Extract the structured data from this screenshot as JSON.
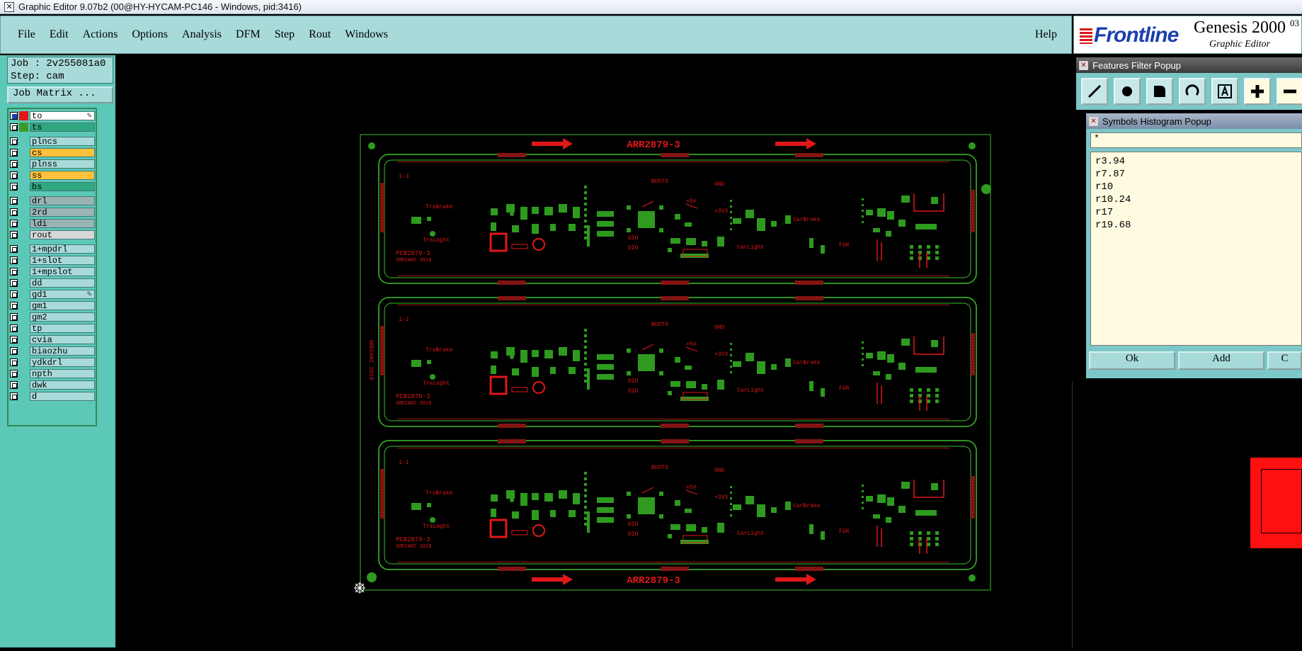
{
  "window": {
    "title": "Graphic Editor 9.07b2 (00@HY-HYCAM-PC146 - Windows, pid:3416)"
  },
  "menu": {
    "items": [
      "File",
      "Edit",
      "Actions",
      "Options",
      "Analysis",
      "DFM",
      "Step",
      "Rout",
      "Windows"
    ],
    "help": "Help"
  },
  "brand": {
    "logo": "Frontline",
    "product": "Genesis 2000",
    "product_sup": "03",
    "subtitle": "Graphic Editor"
  },
  "job": {
    "job_line": "Job : 2v255081a0",
    "step_line": "Step: cam",
    "matrix_button": "Job Matrix ..."
  },
  "layers": [
    {
      "name": "to",
      "color": "#ffffff",
      "swatch": "#e01818",
      "checked": true,
      "editable": true
    },
    {
      "name": "ts",
      "color": "#2fa882",
      "swatch": "#3a9b2a",
      "checked": false
    },
    {
      "name": "plncs",
      "color": "#a8dada",
      "swatch": "",
      "checked": false
    },
    {
      "name": "cs",
      "color": "#ffc23a",
      "swatch": "",
      "checked": false
    },
    {
      "name": "plnss",
      "color": "#a8dada",
      "swatch": "",
      "checked": false
    },
    {
      "name": "ss",
      "color": "#ffc23a",
      "swatch": "",
      "checked": false
    },
    {
      "name": "bs",
      "color": "#2fa882",
      "swatch": "",
      "checked": false
    },
    {
      "name": "drl",
      "color": "#9ab4b4",
      "swatch": "",
      "checked": false
    },
    {
      "name": "2rd",
      "color": "#9ab4b4",
      "swatch": "",
      "checked": false
    },
    {
      "name": "ldi",
      "color": "#9ab4b4",
      "swatch": "",
      "checked": false
    },
    {
      "name": "rout",
      "color": "#d8d8d8",
      "swatch": "",
      "checked": false
    },
    {
      "name": "1+mpdrl",
      "color": "#a8dada",
      "swatch": "",
      "checked": false
    },
    {
      "name": "1+slot",
      "color": "#a8dada",
      "swatch": "",
      "checked": false
    },
    {
      "name": "1+mpslot",
      "color": "#a8dada",
      "swatch": "",
      "checked": false
    },
    {
      "name": "dd",
      "color": "#a8dada",
      "swatch": "",
      "checked": false
    },
    {
      "name": "gd1",
      "color": "#a8dada",
      "swatch": "",
      "checked": false,
      "editable": true
    },
    {
      "name": "gm1",
      "color": "#a8dada",
      "swatch": "",
      "checked": false
    },
    {
      "name": "gm2",
      "color": "#a8dada",
      "swatch": "",
      "checked": false
    },
    {
      "name": "tp",
      "color": "#a8dada",
      "swatch": "",
      "checked": false
    },
    {
      "name": "cvia",
      "color": "#a8dada",
      "swatch": "",
      "checked": false
    },
    {
      "name": "biaozhu",
      "color": "#a8dada",
      "swatch": "",
      "checked": false
    },
    {
      "name": "ydkdrl",
      "color": "#a8dada",
      "swatch": "",
      "checked": false
    },
    {
      "name": "npth",
      "color": "#a8dada",
      "swatch": "",
      "checked": false
    },
    {
      "name": "dwk",
      "color": "#a8dada",
      "swatch": "",
      "checked": false
    },
    {
      "name": "d",
      "color": "#a8dada",
      "swatch": "",
      "checked": false
    }
  ],
  "board": {
    "panel_label_top": "ARR2879-3",
    "panel_label_bottom": "ARR2879-3",
    "side_label": "SRECARC 2018",
    "units": [
      {
        "id": "1-3",
        "part": "PCB2879-3",
        "date": "SRECARC 2018"
      },
      {
        "id": "1-2",
        "part": "PCB2879-3",
        "date": "SRECARC 2018"
      },
      {
        "id": "1-1",
        "part": "PCB2879-3",
        "date": "SRECARC 2018"
      }
    ],
    "net_labels": [
      "TrsBrake",
      "Traiaght",
      "BOOTO",
      "GND",
      "+5V",
      "+3V3",
      "CarBrake",
      "CarLight",
      "FSR",
      "DIO",
      "DIO"
    ],
    "colors": {
      "outline": "#3cbf2a",
      "copper": "#2e9b1f",
      "silk": "#e01818",
      "hatch": "#a01515"
    }
  },
  "features_filter": {
    "title": "Features Filter Popup",
    "buttons": [
      "line-icon",
      "pad-icon",
      "surface-icon",
      "arc-icon",
      "text-icon",
      "plus-icon",
      "minus-icon"
    ]
  },
  "symbols_histogram": {
    "title": "Symbols Histogram Popup",
    "filter": "*",
    "symbols": [
      "r3.94",
      "r7.87",
      "r10",
      "r10.24",
      "r17",
      "r19.68"
    ],
    "ok_label": "Ok",
    "add_label": "Add",
    "close_label": "C"
  }
}
